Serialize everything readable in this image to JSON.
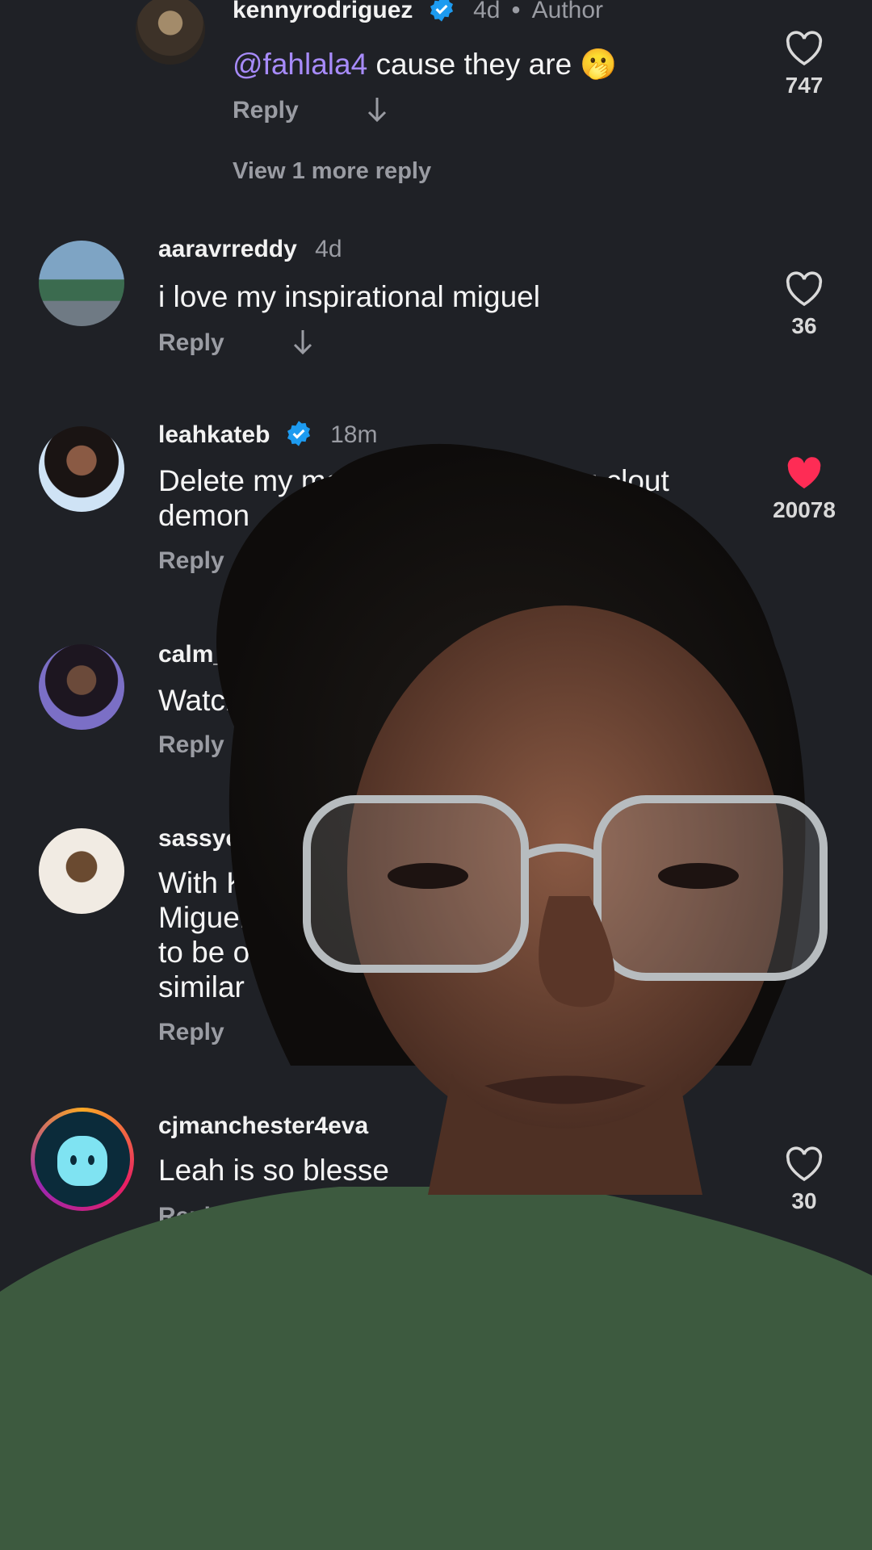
{
  "comments": [
    {
      "username": "kennyrodriguez",
      "time": "4d",
      "dot": "•",
      "author_label": "Author",
      "mention": "@fahlala4",
      "text": " cause they are 🫢",
      "reply": "Reply",
      "likes": "747",
      "verified": true
    },
    {
      "view_more": "View 1 more reply"
    },
    {
      "username": "aaravrreddy",
      "time": "4d",
      "text": "i love my inspirational miguel",
      "reply": "Reply",
      "likes": "36"
    },
    {
      "username": "leahkateb",
      "time": "18m",
      "text_line1": "Delete my man off your page you clout",
      "text_line2": "demon",
      "reply": "Reply",
      "likes": "20078",
      "liked": true,
      "verified": true
    },
    {
      "username": "calm_collecte",
      "text": "Watching t",
      "reply": "Reply"
    },
    {
      "username": "sassycjc_1",
      "text_line1": "With Ken",
      "text_line2": "Miguel’s",
      "text_line3": "to be on",
      "text_line4": "similar",
      "reply": "Reply"
    },
    {
      "username": "cjmanchester4eva",
      "text": "Leah is so blesse",
      "reply": "Reply",
      "likes": "30"
    }
  ],
  "colors": {
    "background": "#1f2126",
    "verified": "#1d9bf0",
    "liked_heart": "#fe2c55",
    "muted": "#9a9ca3"
  },
  "icons": [
    "heart-icon",
    "heart-filled-icon",
    "verified-badge-icon",
    "down-arrow-icon"
  ]
}
